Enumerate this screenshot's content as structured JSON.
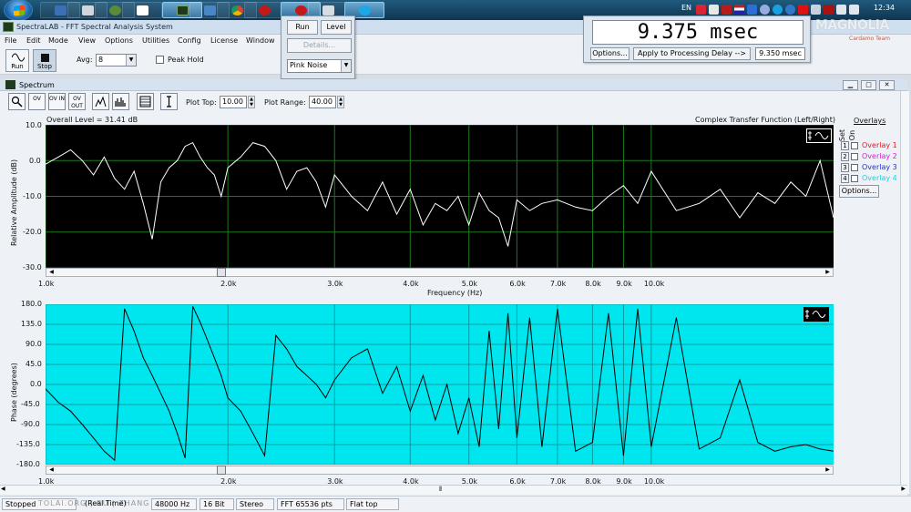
{
  "taskbar": {
    "language": "EN",
    "clock": "12:34"
  },
  "app": {
    "title": "SpectraLAB - FFT Spectral Analysis System",
    "menu": [
      "File",
      "Edit",
      "Mode",
      "View",
      "Options",
      "Utilities",
      "Config",
      "License",
      "Window"
    ],
    "toolbar": {
      "run_label": "Run",
      "stop_label": "Stop",
      "avg_label": "Avg:",
      "avg_value": "8",
      "peak_hold_label": "Peak Hold"
    }
  },
  "generator": {
    "run_label": "Run",
    "level_label": "Level",
    "details_label": "Details...",
    "signal": "Pink Noise"
  },
  "delay": {
    "display": "9.375 msec",
    "options_label": "Options...",
    "apply_label": "Apply to Processing Delay -->",
    "applied_value": "9.350 msec"
  },
  "watermark": {
    "logo": "MAGNOLIA",
    "team": "Cardamo Team"
  },
  "spectrum": {
    "window_title": "Spectrum",
    "toolbar_buttons": [
      {
        "icon": "zoom-icon",
        "text": ""
      },
      {
        "icon": "overlay-icon",
        "text": "OV"
      },
      {
        "icon": "overlay-in-icon",
        "text": "OV IN"
      },
      {
        "icon": "overlay-out-icon",
        "text": "OV OUT"
      },
      {
        "icon": "lines-icon",
        "text": ""
      },
      {
        "icon": "bars-icon",
        "text": ""
      },
      {
        "icon": "table-icon",
        "text": ""
      },
      {
        "icon": "cursor-icon",
        "text": ""
      }
    ],
    "plot_top_label": "Plot Top:",
    "plot_top_value": "10.00",
    "plot_range_label": "Plot Range:",
    "plot_range_value": "40.00",
    "overall_level": "Overall Level = 31.41 dB",
    "transfer_label": "Complex Transfer Function (Left/Right)",
    "amp_ylabel": "Relative Amplitude (dB)",
    "amp_yticks": [
      "10.0",
      "0.0",
      "-10.0",
      "-20.0",
      "-30.0"
    ],
    "phase_ylabel": "Phase (degrees)",
    "phase_yticks": [
      "180.0",
      "135.0",
      "90.0",
      "45.0",
      "0.0",
      "-45.0",
      "-90.0",
      "-135.0",
      "-180.0"
    ],
    "xticks": [
      "1.0k",
      "2.0k",
      "3.0k",
      "4.0k",
      "5.0k",
      "6.0k",
      "7.0k",
      "8.0k",
      "9.0k",
      "10.0k"
    ],
    "xlabel": "Frequency (Hz)",
    "overlays_title": "Overlays",
    "set_label": "Set",
    "on_label": "On",
    "overlays": [
      {
        "num": "1",
        "name": "Overlay 1",
        "color": "#e8141e"
      },
      {
        "num": "2",
        "name": "Overlay 2",
        "color": "#e316e3"
      },
      {
        "num": "3",
        "name": "Overlay 3",
        "color": "#1e2fd8"
      },
      {
        "num": "4",
        "name": "Overlay 4",
        "color": "#18d4dc"
      }
    ],
    "options_label": "Options..."
  },
  "status": {
    "mode": "Stopped",
    "watermark": "TOLAI.ORG | RU | ZHANG | .NET",
    "realtime": "(Real Time)",
    "rate": "48000 Hz",
    "bits": "16 Bit",
    "channels": "Stereo",
    "fft": "FFT 65536 pts",
    "window": "Flat top"
  },
  "colors": {
    "amp_bg": "#000000",
    "amp_trace": "#ffffff",
    "amp_grid": "#1c7a1c",
    "phase_bg": "#00e6ef",
    "phase_trace": "#000000",
    "phase_grid": "#0a9ca2"
  },
  "chart_data": [
    {
      "type": "line",
      "xlabel": "Frequency (Hz)",
      "ylabel": "Relative Amplitude (dB)",
      "x_scale": "log",
      "xlim": [
        1000,
        20000
      ],
      "ylim": [
        -30,
        10
      ],
      "grid": true,
      "x": [
        1000,
        1050,
        1100,
        1150,
        1200,
        1250,
        1300,
        1350,
        1400,
        1450,
        1500,
        1550,
        1600,
        1650,
        1700,
        1750,
        1800,
        1850,
        1900,
        1950,
        2000,
        2100,
        2200,
        2300,
        2400,
        2500,
        2600,
        2700,
        2800,
        2900,
        3000,
        3200,
        3400,
        3600,
        3800,
        4000,
        4200,
        4400,
        4600,
        4800,
        5000,
        5200,
        5400,
        5600,
        5800,
        6000,
        6300,
        6600,
        7000,
        7500,
        8000,
        8500,
        9000,
        9500,
        10000,
        11000,
        12000,
        13000,
        14000,
        15000,
        16000,
        17000,
        18000,
        19000,
        20000
      ],
      "series": [
        {
          "values": [
            -1,
            1,
            3,
            0,
            -4,
            1,
            -5,
            -8,
            -3,
            -12,
            -22,
            -6,
            -2,
            0,
            4,
            5,
            1,
            -2,
            -4,
            -10,
            -2,
            1,
            5,
            4,
            0,
            -8,
            -3,
            -2,
            -6,
            -13,
            -4,
            -10,
            -14,
            -6,
            -15,
            -8,
            -18,
            -12,
            -14,
            -10,
            -18,
            -9,
            -14,
            -16,
            -24,
            -11,
            -14,
            -12,
            -11,
            -13,
            -14,
            -10,
            -7,
            -12,
            -3,
            -14,
            -12,
            -8,
            -16,
            -9,
            -12,
            -6,
            -10,
            0,
            -16
          ]
        }
      ]
    },
    {
      "type": "line",
      "xlabel": "Frequency (Hz)",
      "ylabel": "Phase (degrees)",
      "x_scale": "log",
      "xlim": [
        1000,
        20000
      ],
      "ylim": [
        -180,
        180
      ],
      "grid": true,
      "x": [
        1000,
        1050,
        1100,
        1150,
        1200,
        1250,
        1300,
        1350,
        1400,
        1450,
        1500,
        1550,
        1600,
        1650,
        1700,
        1750,
        1800,
        1850,
        1900,
        1950,
        2000,
        2100,
        2200,
        2300,
        2400,
        2500,
        2600,
        2700,
        2800,
        2900,
        3000,
        3200,
        3400,
        3600,
        3800,
        4000,
        4200,
        4400,
        4600,
        4800,
        5000,
        5200,
        5400,
        5600,
        5800,
        6000,
        6300,
        6600,
        7000,
        7500,
        8000,
        8500,
        9000,
        9500,
        10000,
        11000,
        12000,
        13000,
        14000,
        15000,
        16000,
        17000,
        18000,
        19000,
        20000
      ],
      "series": [
        {
          "values": [
            -10,
            -40,
            -60,
            -90,
            -120,
            -150,
            -170,
            170,
            120,
            60,
            20,
            -20,
            -60,
            -110,
            -165,
            175,
            140,
            100,
            60,
            20,
            -30,
            -60,
            -110,
            -160,
            110,
            80,
            40,
            20,
            0,
            -30,
            10,
            60,
            80,
            -20,
            40,
            -60,
            20,
            -80,
            0,
            -110,
            -30,
            -140,
            120,
            -100,
            160,
            -120,
            150,
            -140,
            170,
            -150,
            -130,
            160,
            -160,
            170,
            -140,
            150,
            -145,
            -120,
            10,
            -130,
            -150,
            -140,
            -135,
            -145,
            -150
          ]
        }
      ]
    }
  ]
}
